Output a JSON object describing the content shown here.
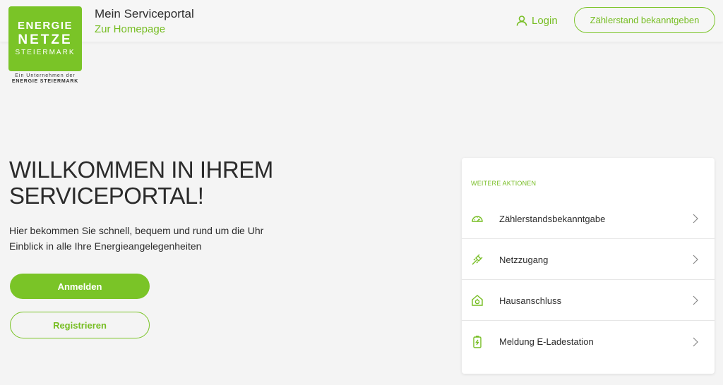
{
  "header": {
    "logo": {
      "line1": "ENERGIE",
      "line2": "NETZE",
      "line3": "STEIERMARK",
      "sub1": "Ein Unternehmen der",
      "sub2": "ENERGIE STEIERMARK"
    },
    "title": "Mein Serviceportal",
    "homepage_link": "Zur Homepage",
    "login_label": "Login",
    "meter_button": "Zählerstand bekanntgeben"
  },
  "main": {
    "welcome_line1": "WILLKOMMEN IN IHREM",
    "welcome_line2": "SERVICEPORTAL!",
    "intro_line1": "Hier bekommen Sie schnell, bequem und rund um die Uhr",
    "intro_line2": "Einblick in alle Ihre Energieangelegenheiten",
    "login_button": "Anmelden",
    "register_button": "Registrieren"
  },
  "actions": {
    "title": "WEITERE AKTIONEN",
    "items": [
      {
        "label": "Zählerstandsbekanntgabe",
        "icon": "gauge-icon"
      },
      {
        "label": "Netzzugang",
        "icon": "plug-icon"
      },
      {
        "label": "Hausanschluss",
        "icon": "house-connection-icon"
      },
      {
        "label": "Meldung E-Ladestation",
        "icon": "charging-station-icon"
      }
    ]
  },
  "colors": {
    "brand_green": "#7ac427",
    "text": "#2b2b2b",
    "background": "#f4f4f4"
  }
}
